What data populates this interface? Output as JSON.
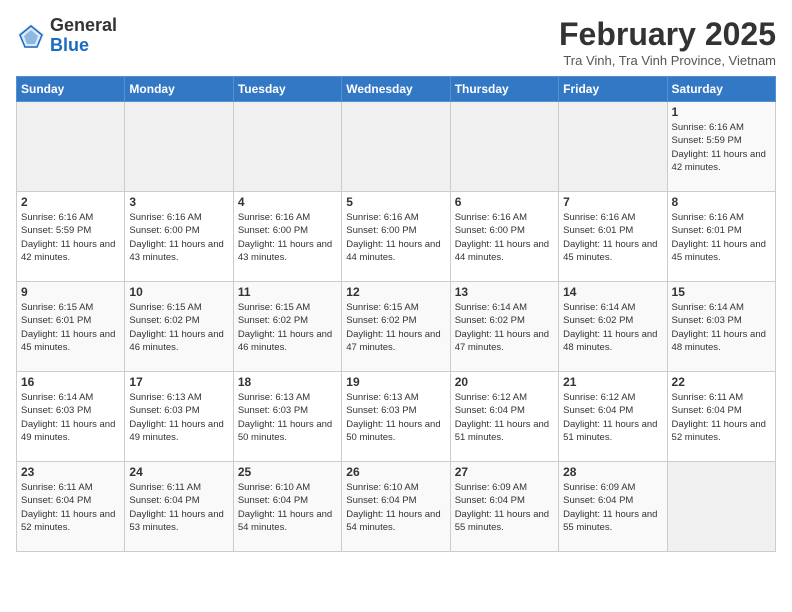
{
  "header": {
    "logo_general": "General",
    "logo_blue": "Blue",
    "month_title": "February 2025",
    "subtitle": "Tra Vinh, Tra Vinh Province, Vietnam"
  },
  "weekdays": [
    "Sunday",
    "Monday",
    "Tuesday",
    "Wednesday",
    "Thursday",
    "Friday",
    "Saturday"
  ],
  "weeks": [
    [
      {
        "day": "",
        "info": ""
      },
      {
        "day": "",
        "info": ""
      },
      {
        "day": "",
        "info": ""
      },
      {
        "day": "",
        "info": ""
      },
      {
        "day": "",
        "info": ""
      },
      {
        "day": "",
        "info": ""
      },
      {
        "day": "1",
        "info": "Sunrise: 6:16 AM\nSunset: 5:59 PM\nDaylight: 11 hours and 42 minutes."
      }
    ],
    [
      {
        "day": "2",
        "info": "Sunrise: 6:16 AM\nSunset: 5:59 PM\nDaylight: 11 hours and 42 minutes."
      },
      {
        "day": "3",
        "info": "Sunrise: 6:16 AM\nSunset: 6:00 PM\nDaylight: 11 hours and 43 minutes."
      },
      {
        "day": "4",
        "info": "Sunrise: 6:16 AM\nSunset: 6:00 PM\nDaylight: 11 hours and 43 minutes."
      },
      {
        "day": "5",
        "info": "Sunrise: 6:16 AM\nSunset: 6:00 PM\nDaylight: 11 hours and 44 minutes."
      },
      {
        "day": "6",
        "info": "Sunrise: 6:16 AM\nSunset: 6:00 PM\nDaylight: 11 hours and 44 minutes."
      },
      {
        "day": "7",
        "info": "Sunrise: 6:16 AM\nSunset: 6:01 PM\nDaylight: 11 hours and 45 minutes."
      },
      {
        "day": "8",
        "info": "Sunrise: 6:16 AM\nSunset: 6:01 PM\nDaylight: 11 hours and 45 minutes."
      }
    ],
    [
      {
        "day": "9",
        "info": "Sunrise: 6:15 AM\nSunset: 6:01 PM\nDaylight: 11 hours and 45 minutes."
      },
      {
        "day": "10",
        "info": "Sunrise: 6:15 AM\nSunset: 6:02 PM\nDaylight: 11 hours and 46 minutes."
      },
      {
        "day": "11",
        "info": "Sunrise: 6:15 AM\nSunset: 6:02 PM\nDaylight: 11 hours and 46 minutes."
      },
      {
        "day": "12",
        "info": "Sunrise: 6:15 AM\nSunset: 6:02 PM\nDaylight: 11 hours and 47 minutes."
      },
      {
        "day": "13",
        "info": "Sunrise: 6:14 AM\nSunset: 6:02 PM\nDaylight: 11 hours and 47 minutes."
      },
      {
        "day": "14",
        "info": "Sunrise: 6:14 AM\nSunset: 6:02 PM\nDaylight: 11 hours and 48 minutes."
      },
      {
        "day": "15",
        "info": "Sunrise: 6:14 AM\nSunset: 6:03 PM\nDaylight: 11 hours and 48 minutes."
      }
    ],
    [
      {
        "day": "16",
        "info": "Sunrise: 6:14 AM\nSunset: 6:03 PM\nDaylight: 11 hours and 49 minutes."
      },
      {
        "day": "17",
        "info": "Sunrise: 6:13 AM\nSunset: 6:03 PM\nDaylight: 11 hours and 49 minutes."
      },
      {
        "day": "18",
        "info": "Sunrise: 6:13 AM\nSunset: 6:03 PM\nDaylight: 11 hours and 50 minutes."
      },
      {
        "day": "19",
        "info": "Sunrise: 6:13 AM\nSunset: 6:03 PM\nDaylight: 11 hours and 50 minutes."
      },
      {
        "day": "20",
        "info": "Sunrise: 6:12 AM\nSunset: 6:04 PM\nDaylight: 11 hours and 51 minutes."
      },
      {
        "day": "21",
        "info": "Sunrise: 6:12 AM\nSunset: 6:04 PM\nDaylight: 11 hours and 51 minutes."
      },
      {
        "day": "22",
        "info": "Sunrise: 6:11 AM\nSunset: 6:04 PM\nDaylight: 11 hours and 52 minutes."
      }
    ],
    [
      {
        "day": "23",
        "info": "Sunrise: 6:11 AM\nSunset: 6:04 PM\nDaylight: 11 hours and 52 minutes."
      },
      {
        "day": "24",
        "info": "Sunrise: 6:11 AM\nSunset: 6:04 PM\nDaylight: 11 hours and 53 minutes."
      },
      {
        "day": "25",
        "info": "Sunrise: 6:10 AM\nSunset: 6:04 PM\nDaylight: 11 hours and 54 minutes."
      },
      {
        "day": "26",
        "info": "Sunrise: 6:10 AM\nSunset: 6:04 PM\nDaylight: 11 hours and 54 minutes."
      },
      {
        "day": "27",
        "info": "Sunrise: 6:09 AM\nSunset: 6:04 PM\nDaylight: 11 hours and 55 minutes."
      },
      {
        "day": "28",
        "info": "Sunrise: 6:09 AM\nSunset: 6:04 PM\nDaylight: 11 hours and 55 minutes."
      },
      {
        "day": "",
        "info": ""
      }
    ]
  ]
}
